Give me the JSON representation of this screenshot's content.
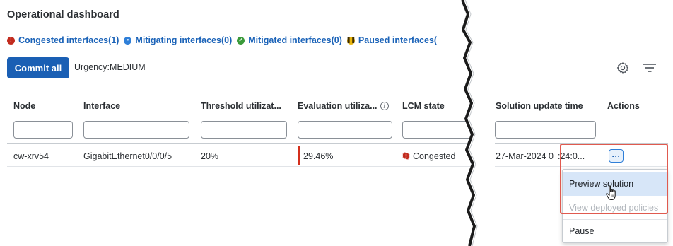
{
  "page": {
    "title": "Operational dashboard"
  },
  "status": [
    {
      "label": "Congested interfaces(1)",
      "color": "#c22b1e",
      "icon": "alert-icon"
    },
    {
      "label": "Mitigating interfaces(0)",
      "color": "#2f7fd8",
      "icon": "mitigating-icon"
    },
    {
      "label": "Mitigated  interfaces(0)",
      "color": "#3a9a3a",
      "icon": "check-icon"
    },
    {
      "label": "Paused interfaces(",
      "color": "#e8b50c",
      "icon": "pause-icon"
    }
  ],
  "toolbar": {
    "commit_label": "Commit all",
    "urgency_label": "Urgency:",
    "urgency_value": "MEDIUM",
    "settings_icon": "gear-icon",
    "filter_icon": "filter-icon"
  },
  "table": {
    "columns": [
      "Node",
      "Interface",
      "Threshold utilizat...",
      "Evaluation utiliza...",
      "LCM state",
      "Solution update time",
      "Actions"
    ],
    "filters": [
      "",
      "",
      "",
      "",
      "",
      ""
    ],
    "rows": [
      {
        "node": "cw-xrv54",
        "interface": "GigabitEthernet0/0/0/5",
        "threshold": "20%",
        "evaluation": "29.46%",
        "lcm_state": "Congested",
        "solution_update_time": "27-Mar-2024 0",
        "solution_update_time_tail": ":24:0...",
        "actions_label": "···"
      }
    ]
  },
  "menu": {
    "items": [
      {
        "label": "Preview solution",
        "state": "hover"
      },
      {
        "label": "View deployed policies",
        "state": "disabled"
      },
      {
        "label": "Pause",
        "state": "normal"
      }
    ]
  },
  "colors": {
    "accent": "#1a5fb4",
    "congested": "#d42f1c",
    "highlight": "#e05a4f"
  }
}
